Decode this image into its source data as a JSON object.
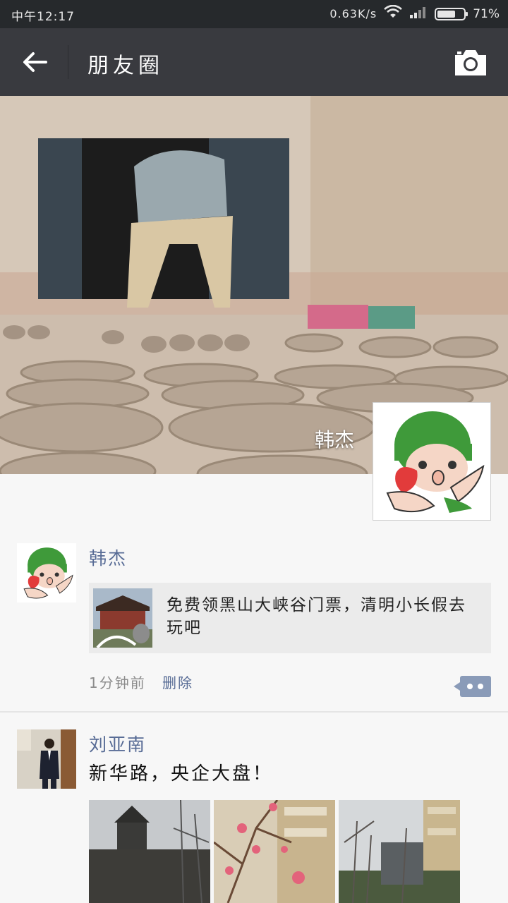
{
  "status_bar": {
    "time": "中午12:17",
    "net_speed": "0.63K/s",
    "battery": "71%",
    "battery_level": 0.71,
    "icons": [
      "wifi-icon",
      "signal-icon",
      "battery-icon"
    ]
  },
  "header": {
    "title": "朋友圈",
    "back_icon": "arrow-left-icon",
    "camera_icon": "camera-icon"
  },
  "cover": {
    "user_name": "韩杰"
  },
  "posts": [
    {
      "author": "韩杰",
      "shared_link": {
        "title": "免费领黑山大峡谷门票，清明小长假去玩吧"
      },
      "time": "1分钟前",
      "delete_label": "删除",
      "comment_icon": "comment-dots-icon"
    },
    {
      "author": "刘亚南",
      "text": "新华路，央企大盘！"
    }
  ],
  "colors": {
    "title_bar": "#393a3f",
    "status_bar": "#26292c",
    "link_blue": "#576b95",
    "background": "#f7f7f7"
  }
}
